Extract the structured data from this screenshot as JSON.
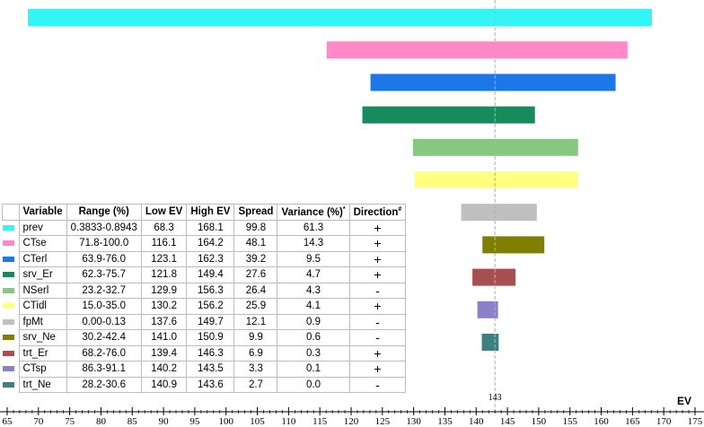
{
  "chart_data": {
    "type": "tornado",
    "xlabel": "EV",
    "xlim": [
      65,
      175
    ],
    "xticks": [
      65,
      70,
      75,
      80,
      85,
      90,
      95,
      100,
      105,
      110,
      115,
      120,
      125,
      130,
      135,
      140,
      145,
      150,
      155,
      160,
      165,
      170,
      175
    ],
    "baseline": 143,
    "baseline_label": "143",
    "table_headers": {
      "variable": "Variable",
      "range": "Range (%)",
      "low": "Low EV",
      "high": "High EV",
      "spread": "Spread",
      "variance": "Variance (%)",
      "variance_mark": "*",
      "direction": "Direction",
      "direction_mark": "#"
    },
    "rows": [
      {
        "variable": "prev",
        "range": "0.3833-0.8943",
        "low": 68.3,
        "high": 168.1,
        "spread": 99.8,
        "variance": 61.3,
        "direction": "+",
        "color": "#33f5f5"
      },
      {
        "variable": "CTse",
        "range": "71.8-100.0",
        "low": 116.1,
        "high": 164.2,
        "spread": 48.1,
        "variance": 14.3,
        "direction": "+",
        "color": "#ff88c8"
      },
      {
        "variable": "CTerl",
        "range": "63.9-76.0",
        "low": 123.1,
        "high": 162.3,
        "spread": 39.2,
        "variance": 9.5,
        "direction": "+",
        "color": "#1c78e8"
      },
      {
        "variable": "srv_Er",
        "range": "62.3-75.7",
        "low": 121.8,
        "high": 149.4,
        "spread": 27.6,
        "variance": 4.7,
        "direction": "+",
        "color": "#168c5c"
      },
      {
        "variable": "NSerl",
        "range": "23.2-32.7",
        "low": 129.9,
        "high": 156.3,
        "spread": 26.4,
        "variance": 4.3,
        "direction": "-",
        "color": "#86c882"
      },
      {
        "variable": "CTidl",
        "range": "15.0-35.0",
        "low": 130.2,
        "high": 156.2,
        "spread": 25.9,
        "variance": 4.1,
        "direction": "+",
        "color": "#ffff80"
      },
      {
        "variable": "fpMt",
        "range": "0.00-0.13",
        "low": 137.6,
        "high": 149.7,
        "spread": 12.1,
        "variance": 0.9,
        "direction": "-",
        "color": "#c0c0c0"
      },
      {
        "variable": "srv_Ne",
        "range": "30.2-42.4",
        "low": 141.0,
        "high": 150.9,
        "spread": 9.9,
        "variance": 0.6,
        "direction": "-",
        "color": "#808000"
      },
      {
        "variable": "trt_Er",
        "range": "68.2-76.0",
        "low": 139.4,
        "high": 146.3,
        "spread": 6.9,
        "variance": 0.3,
        "direction": "+",
        "color": "#a85050"
      },
      {
        "variable": "CTsp",
        "range": "86.3-91.1",
        "low": 140.2,
        "high": 143.5,
        "spread": 3.3,
        "variance": 0.1,
        "direction": "+",
        "color": "#8c80c8"
      },
      {
        "variable": "trt_Ne",
        "range": "28.2-30.6",
        "low": 140.9,
        "high": 143.6,
        "spread": 2.7,
        "variance": 0.0,
        "direction": "-",
        "color": "#3c8080"
      }
    ]
  }
}
